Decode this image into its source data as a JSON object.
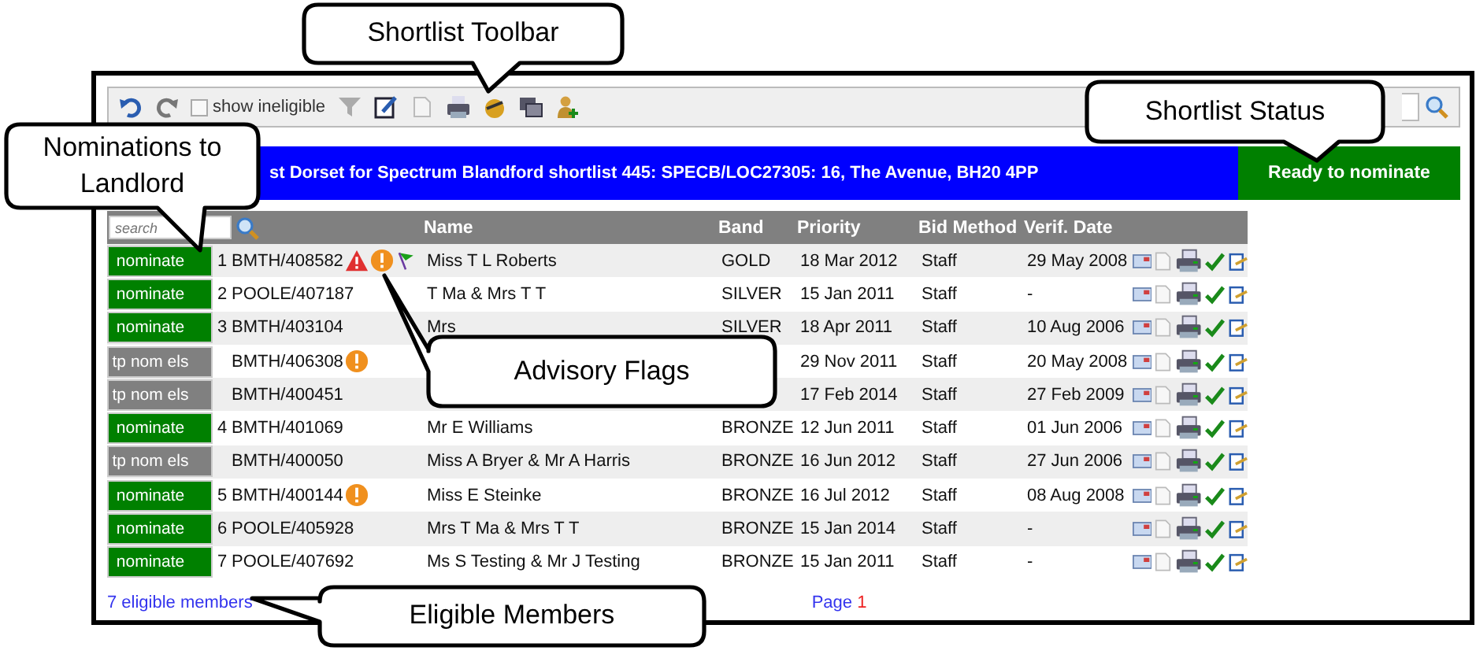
{
  "toolbar": {
    "show_ineligible": {
      "label": "show ineligible",
      "checked": false
    }
  },
  "shortlist_title": "st Dorset for Spectrum Blandford shortlist 445: SPECB/LOC27305: 16, The Avenue, BH20 4PP",
  "status": "Ready to nominate",
  "table": {
    "search_placeholder": "search",
    "columns": [
      "Name",
      "Band",
      "Priority",
      "Bid Method",
      "Verif. Date"
    ],
    "rows": [
      {
        "action": {
          "label": "nominate",
          "kind": "nominate"
        },
        "rank": "1",
        "ref": "BMTH/408582",
        "flags": [
          {
            "kind": "warning"
          },
          {
            "kind": "alert"
          },
          {
            "kind": "flag"
          }
        ],
        "name": "Miss T L Roberts",
        "band": "GOLD",
        "priority": "18 Mar 2012",
        "bid_method": "Staff",
        "verif_date": "29 May 2008"
      },
      {
        "action": {
          "label": "nominate",
          "kind": "nominate"
        },
        "rank": "2",
        "ref": "POOLE/407187",
        "flags": [],
        "name": "T Ma & Mrs T T",
        "band": "SILVER",
        "priority": "15 Jan 2011",
        "bid_method": "Staff",
        "verif_date": "-"
      },
      {
        "action": {
          "label": "nominate",
          "kind": "nominate"
        },
        "rank": "3",
        "ref": "BMTH/403104",
        "flags": [],
        "name": "Mrs",
        "band": "SILVER",
        "priority": "18 Apr 2011",
        "bid_method": "Staff",
        "verif_date": "10 Aug 2006"
      },
      {
        "action": {
          "label": "tp nom els",
          "kind": "ineligible"
        },
        "ref": "BMTH/406308",
        "flags": [
          {
            "kind": "alert"
          }
        ],
        "priority": "29 Nov 2011",
        "bid_method": "Staff",
        "verif_date": "20 May 2008"
      },
      {
        "action": {
          "label": "tp nom els",
          "kind": "ineligible"
        },
        "ref": "BMTH/400451",
        "flags": [],
        "priority": "17 Feb 2014",
        "bid_method": "Staff",
        "verif_date": "27 Feb 2009"
      },
      {
        "action": {
          "label": "nominate",
          "kind": "nominate"
        },
        "rank": "4",
        "ref": "BMTH/401069",
        "flags": [],
        "name": "Mr E Williams",
        "band": "BRONZE",
        "priority": "12 Jun 2011",
        "bid_method": "Staff",
        "verif_date": "01 Jun 2006"
      },
      {
        "action": {
          "label": "tp nom els",
          "kind": "ineligible"
        },
        "ref": "BMTH/400050",
        "flags": [],
        "name": "Miss A Bryer & Mr A Harris",
        "band": "BRONZE",
        "priority": "16 Jun 2012",
        "bid_method": "Staff",
        "verif_date": "27 Jun 2006"
      },
      {
        "action": {
          "label": "nominate",
          "kind": "nominate"
        },
        "rank": "5",
        "ref": "BMTH/400144",
        "flags": [
          {
            "kind": "alert"
          }
        ],
        "name": "Miss E Steinke",
        "band": "BRONZE",
        "priority": "16 Jul 2012",
        "bid_method": "Staff",
        "verif_date": "08 Aug 2008"
      },
      {
        "action": {
          "label": "nominate",
          "kind": "nominate"
        },
        "rank": "6",
        "ref": "POOLE/405928",
        "flags": [],
        "name": "Mrs T Ma & Mrs T T",
        "band": "BRONZE",
        "priority": "15 Jan 2014",
        "bid_method": "Staff",
        "verif_date": "-"
      },
      {
        "action": {
          "label": "nominate",
          "kind": "nominate"
        },
        "rank": "7",
        "ref": "POOLE/407692",
        "flags": [],
        "name": "Ms S Testing & Mr J Testing",
        "band": "BRONZE",
        "priority": "15 Jan 2011",
        "bid_method": "Staff",
        "verif_date": "-"
      }
    ]
  },
  "footer": {
    "members": "7 eligible members",
    "page_label": "Page",
    "page": "1"
  },
  "callouts": [
    {
      "text": "Shortlist Toolbar"
    },
    {
      "text": "Nominations to Landlord"
    },
    {
      "text": "Shortlist Status"
    },
    {
      "text": "Advisory Flags"
    },
    {
      "text": "Eligible Members"
    }
  ]
}
